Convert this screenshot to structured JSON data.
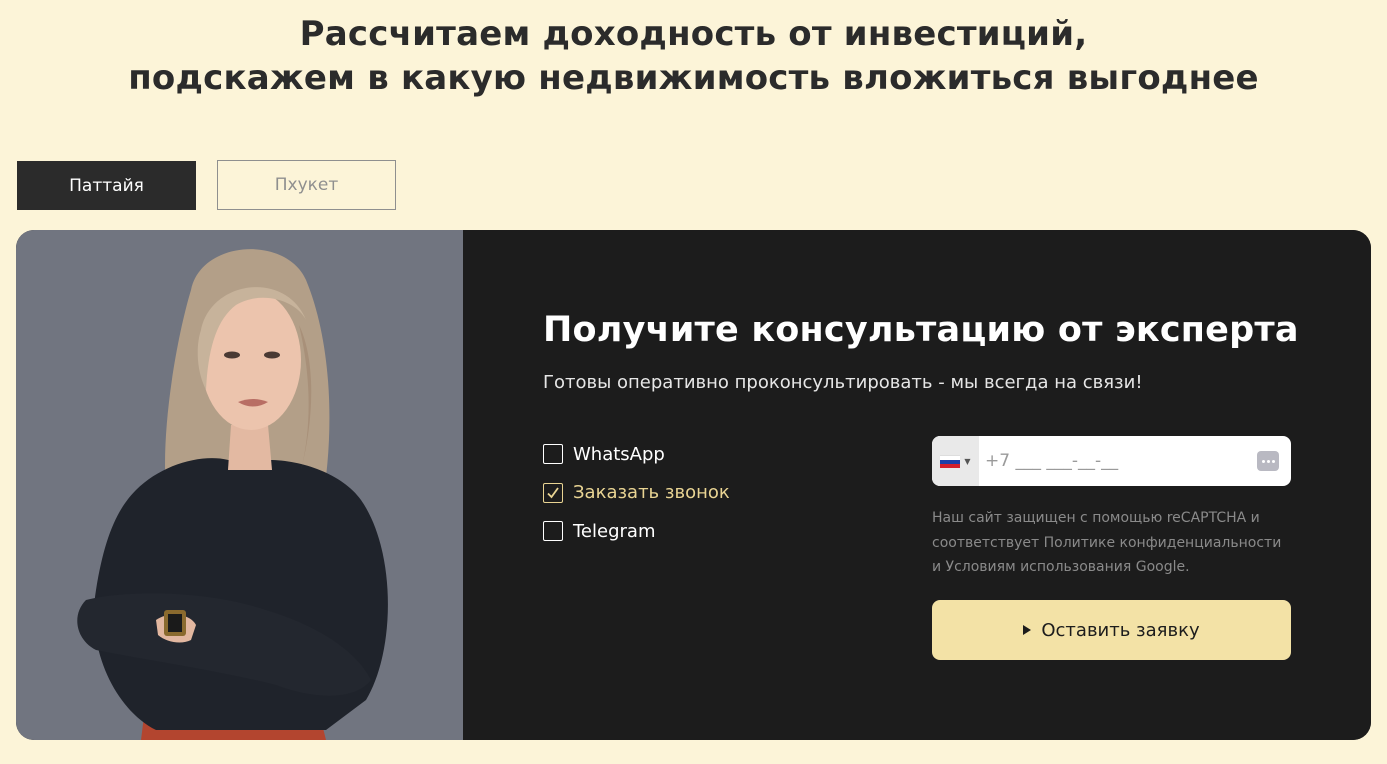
{
  "headline": {
    "line1": "Рассчитаем доходность от инвестиций,",
    "line2": "подскажем в какую недвижимость вложиться выгоднее"
  },
  "tabs": [
    {
      "label": "Паттайя",
      "active": true
    },
    {
      "label": "Пхукет",
      "active": false
    }
  ],
  "form": {
    "title": "Получите консультацию от эксперта",
    "subtitle": "Готовы оперативно проконсультировать - мы всегда на связи!",
    "options": [
      {
        "label": "WhatsApp",
        "checked": false
      },
      {
        "label": "Заказать звонок",
        "checked": true
      },
      {
        "label": "Telegram",
        "checked": false
      }
    ],
    "phone": {
      "country_flag": "russia-flag-icon",
      "placeholder": "+7 ___ ___-__-__"
    },
    "recaptcha_note": "Наш сайт защищен с помощью reCAPTCHA и соответствует Политике конфиденциальности и Условиям использования Google.",
    "submit_label": "Оставить заявку"
  },
  "colors": {
    "page_background": "#fcf4d8",
    "dark_panel": "#1c1c1c",
    "accent": "#e9d493",
    "button": "#f3e2a6",
    "photo_background": "#717580"
  }
}
